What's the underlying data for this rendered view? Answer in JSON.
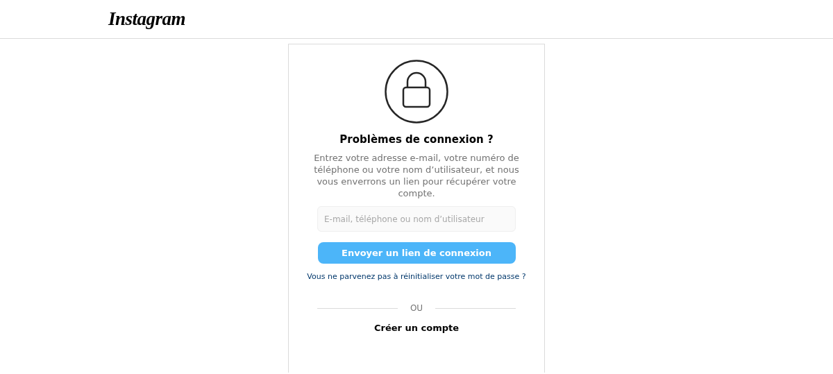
{
  "header": {
    "logo": "Instagram"
  },
  "card": {
    "title": "Problèmes de connexion ?",
    "description": "Entrez votre adresse e-mail, votre numéro de téléphone ou votre nom d’utilisateur, et nous vous enverrons un lien pour récupérer votre compte.",
    "field": {
      "placeholder": "E-mail, téléphone ou nom d’utilisateur"
    },
    "submit_button": "Envoyer un lien de connexion",
    "reset_link": "Vous ne parvenez pas à réinitialiser votre mot de passe ?",
    "separator": "OU",
    "create_account_link": "Créer un compte"
  }
}
